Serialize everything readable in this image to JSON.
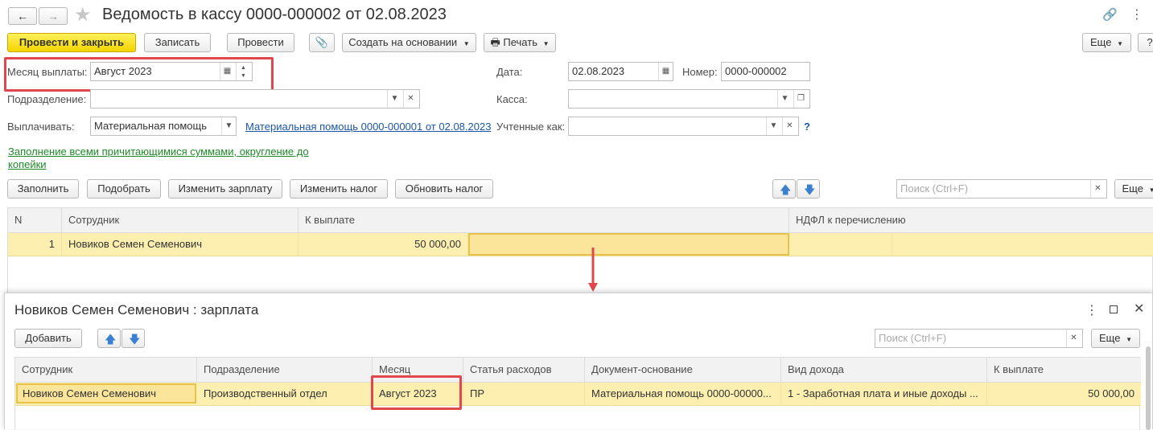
{
  "window": {
    "title": "Ведомость в кассу 0000-000002 от 02.08.2023"
  },
  "toolbar": {
    "post_close": "Провести и закрыть",
    "save": "Записать",
    "post": "Провести",
    "create_based": "Создать на основании",
    "print": "Печать",
    "more": "Еще",
    "help": "?"
  },
  "form": {
    "month_label": "Месяц выплаты:",
    "month_value": "Август 2023",
    "date_label": "Дата:",
    "date_value": "02.08.2023",
    "number_label": "Номер:",
    "number_value": "0000-000002",
    "division_label": "Подразделение:",
    "division_value": "",
    "cash_label": "Касса:",
    "cash_value": "",
    "pay_label": "Выплачивать:",
    "pay_value": "Материальная помощь",
    "pay_link": "Материальная помощь 0000-000001 от 02.08.2023",
    "counted_label": "Учтенные как:",
    "counted_value": "",
    "counted_help": "?",
    "fill_note": "Заполнение всеми причитающимися суммами, округление до копейки"
  },
  "table_toolbar": {
    "fill": "Заполнить",
    "select": "Подобрать",
    "change_salary": "Изменить зарплату",
    "change_tax": "Изменить налог",
    "update_tax": "Обновить налог",
    "search_placeholder": "Поиск (Ctrl+F)",
    "more": "Еще"
  },
  "main_table": {
    "columns": [
      "N",
      "Сотрудник",
      "К выплате",
      "НДФЛ к перечислению"
    ],
    "rows": [
      {
        "n": "1",
        "employee": "Новиков Семен Семенович",
        "amount": "50 000,00",
        "ndfl": ""
      }
    ]
  },
  "subwindow": {
    "title": "Новиков Семен Семенович : зарплата",
    "add": "Добавить",
    "search_placeholder": "Поиск (Ctrl+F)",
    "more": "Еще",
    "columns": [
      "Сотрудник",
      "Подразделение",
      "Месяц",
      "Статья расходов",
      "Документ-основание",
      "Вид дохода",
      "К выплате"
    ],
    "rows": [
      {
        "employee": "Новиков Семен Семенович",
        "division": "Производственный отдел",
        "month": "Август 2023",
        "expense": "ПР",
        "document": "Материальная помощь 0000-00000...",
        "income_type": "1 - Заработная плата и иные доходы ...",
        "amount": "50 000,00"
      }
    ]
  },
  "colors": {
    "accent_yellow": "#f4d400",
    "selected_row": "#fcefb0",
    "highlight_red": "#e0484d",
    "link_blue": "#1b56a8",
    "link_green": "#1e8a29"
  }
}
